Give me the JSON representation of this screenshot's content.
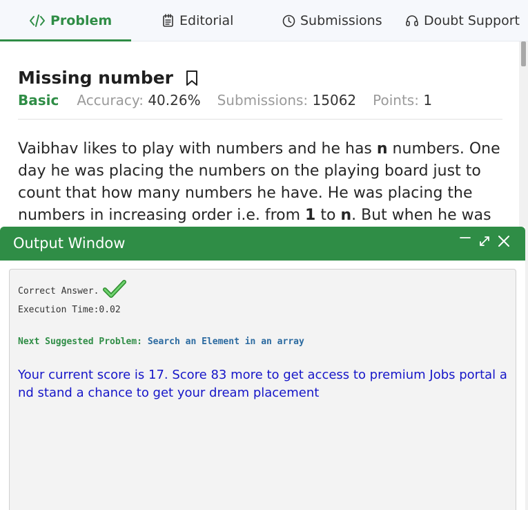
{
  "tabs": [
    {
      "label": "Problem",
      "icon": "code-icon"
    },
    {
      "label": "Editorial",
      "icon": "editorial-icon"
    },
    {
      "label": "Submissions",
      "icon": "clock-icon"
    },
    {
      "label": "Doubt Support",
      "icon": "headset-icon"
    }
  ],
  "problem": {
    "title": "Missing number",
    "difficulty": "Basic",
    "accuracy_label": "Accuracy:",
    "accuracy_value": "40.26%",
    "submissions_label": "Submissions:",
    "submissions_value": "15062",
    "points_label": "Points:",
    "points_value": "1",
    "statement": {
      "p1": "Vaibhav likes to play with numbers and he has ",
      "b1": "n",
      "p2": " numbers. One day he was placing the numbers on the playing board just to count that how many numbers he have. He was placing the numbers in increasing order i.e. from ",
      "b2": "1",
      "p3": " to ",
      "b3": "n",
      "p4": ". But when he was"
    }
  },
  "output_window": {
    "title": "Output Window",
    "correct_text": "Correct Answer.",
    "execution_text": "Execution Time:0.02",
    "next_label": "Next Suggested Problem:",
    "next_problem": "Search an Element in an array",
    "score_text": "Your current score is 17. Score 83 more to get access to premium Jobs portal and stand a chance to get your dream placement"
  },
  "colors": {
    "accent": "#2f8d46",
    "link": "#2b6aa0",
    "score": "#1515c8"
  }
}
